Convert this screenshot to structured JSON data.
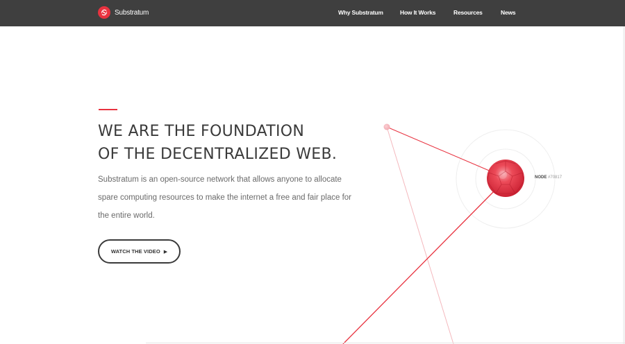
{
  "header": {
    "brand_name": "Substratum",
    "nav": [
      {
        "label": "Why Substratum"
      },
      {
        "label": "How It Works"
      },
      {
        "label": "Resources"
      },
      {
        "label": "News"
      }
    ]
  },
  "hero": {
    "headline_line1": "WE ARE THE FOUNDATION",
    "headline_line2": "OF THE DECENTRALIZED WEB.",
    "description": "Substratum is an open-source network that allows anyone to allocate spare computing resources to make the internet a free and fair place for the entire world.",
    "cta_label": "WATCH THE VIDEO",
    "cta_icon": "play-arrow-icon"
  },
  "network_graphic": {
    "node_prefix": "NODE",
    "node_id": "#70817",
    "accent_color": "#e8323f",
    "sphere_color": "#e03040"
  },
  "colors": {
    "topbar": "#3f3f3f",
    "accent": "#e8323f",
    "text": "#3a3a3a"
  }
}
